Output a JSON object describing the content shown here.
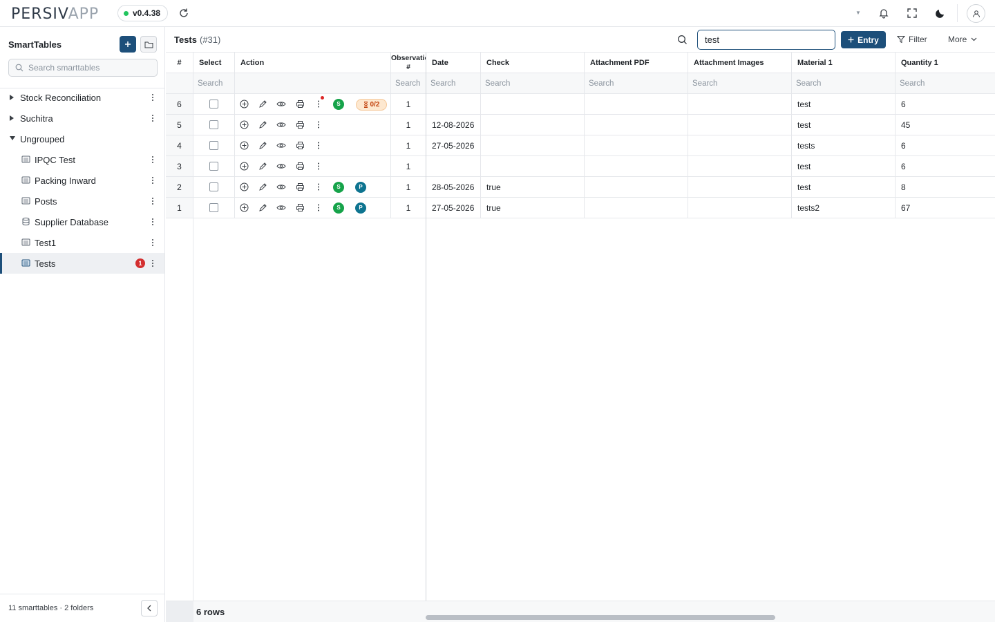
{
  "app": {
    "logo_main": "PERSIV",
    "logo_accent": "APP",
    "version": "v0.4.38"
  },
  "sidebar": {
    "title": "SmartTables",
    "search_placeholder": "Search smarttables",
    "groups": [
      {
        "label": "Stock Reconciliation",
        "expanded": false
      },
      {
        "label": "Suchitra",
        "expanded": false
      },
      {
        "label": "Ungrouped",
        "expanded": true
      }
    ],
    "items": [
      {
        "label": "IPQC Test",
        "icon": "table-icon"
      },
      {
        "label": "Packing Inward",
        "icon": "table-icon"
      },
      {
        "label": "Posts",
        "icon": "table-icon"
      },
      {
        "label": "Supplier Database",
        "icon": "database-icon"
      },
      {
        "label": "Test1",
        "icon": "table-icon"
      },
      {
        "label": "Tests",
        "icon": "table-icon",
        "badge": "1",
        "active": true
      }
    ],
    "footer": "11 smarttables · 2 folders"
  },
  "main": {
    "title": "Tests",
    "count": "(#31)",
    "search_value": "test",
    "entry_label": "Entry",
    "filter_label": "Filter",
    "more_label": "More"
  },
  "table": {
    "columns": {
      "idx": "#",
      "select": "Select",
      "action": "Action",
      "observation": "Observation #",
      "date": "Date",
      "check": "Check",
      "attachment_pdf": "Attachment PDF",
      "attachment_images": "Attachment Images",
      "material1": "Material 1",
      "quantity1": "Quantity 1"
    },
    "filter_placeholder": "Search",
    "rows": [
      {
        "idx": "6",
        "observation": "1",
        "date": "",
        "check": "",
        "material1": "test",
        "quantity1": "6",
        "status": [
          "S"
        ],
        "pending": "0/2",
        "notify": true
      },
      {
        "idx": "5",
        "observation": "1",
        "date": "12-08-2026",
        "check": "",
        "material1": "test",
        "quantity1": "45",
        "status": []
      },
      {
        "idx": "4",
        "observation": "1",
        "date": "27-05-2026",
        "check": "",
        "material1": "tests",
        "quantity1": "6",
        "status": []
      },
      {
        "idx": "3",
        "observation": "1",
        "date": "",
        "check": "",
        "material1": "test",
        "quantity1": "6",
        "status": []
      },
      {
        "idx": "2",
        "observation": "1",
        "date": "28-05-2026",
        "check": "true",
        "material1": "test",
        "quantity1": "8",
        "status": [
          "S",
          "P"
        ]
      },
      {
        "idx": "1",
        "observation": "1",
        "date": "27-05-2026",
        "check": "true",
        "material1": "tests2",
        "quantity1": "67",
        "status": [
          "S",
          "P"
        ]
      }
    ],
    "footer_rows": "6 rows"
  },
  "colors": {
    "primary": "#1d4f7a",
    "success": "#16a34a",
    "teal": "#0e7490",
    "danger": "#d32f2f",
    "pending_bg": "#fde8d0"
  }
}
